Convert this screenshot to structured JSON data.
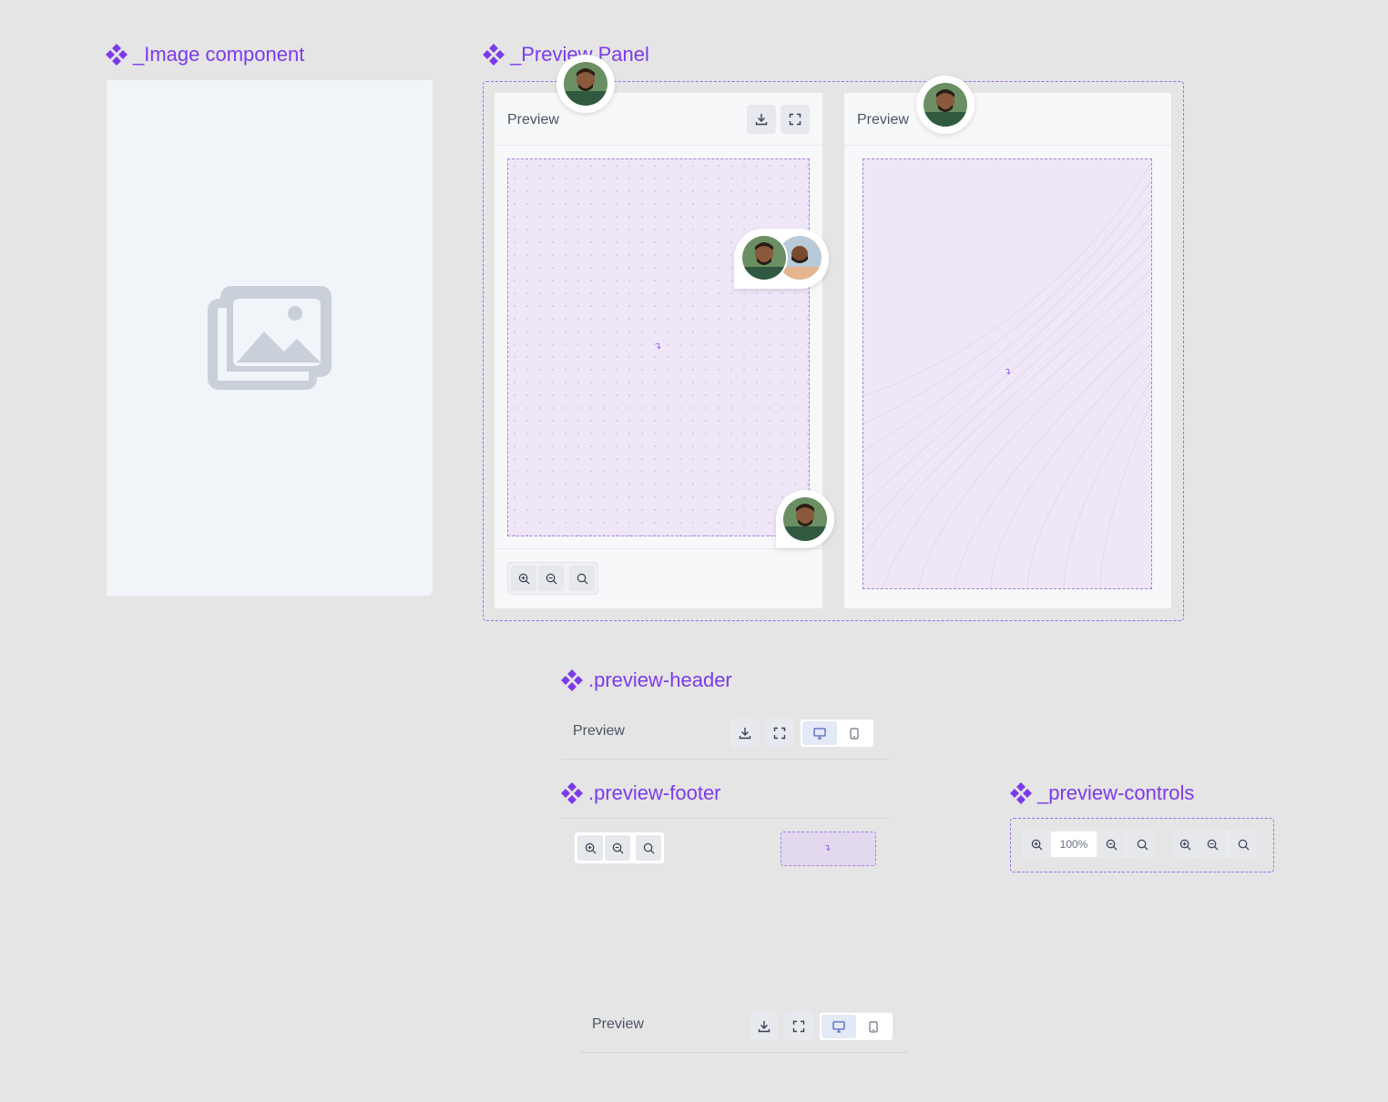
{
  "titles": {
    "image_component": "_Image component",
    "preview_panel": "_Preview Panel",
    "preview_header": ".preview-header",
    "preview_footer": ".preview-footer",
    "preview_controls": "_preview-controls"
  },
  "panel_left": {
    "header_label": "Preview",
    "download_icon": "download-icon",
    "fullscreen_icon": "fullscreen-icon",
    "canvas_pattern": "dots",
    "canvas_mark": "↴",
    "footer_buttons": [
      "zoom-in-icon",
      "zoom-out-icon",
      "zoom-reset-icon"
    ]
  },
  "panel_right": {
    "header_label": "Preview",
    "canvas_pattern": "lines",
    "canvas_mark": "↴"
  },
  "preview_header_component": {
    "label": "Preview",
    "device_options": [
      "desktop",
      "mobile"
    ],
    "selected_device": "desktop"
  },
  "preview_footer_component": {
    "placeholder_mark": "↴"
  },
  "preview_controls_component": {
    "zoom_value": "100%"
  },
  "bottom_header": {
    "label": "Preview",
    "selected_device": "desktop"
  },
  "colors": {
    "accent": "#7c3aed",
    "canvas_bg": "#efe7f8",
    "page_bg": "#e5e5e5",
    "panel_bg": "#f7f8fa"
  }
}
